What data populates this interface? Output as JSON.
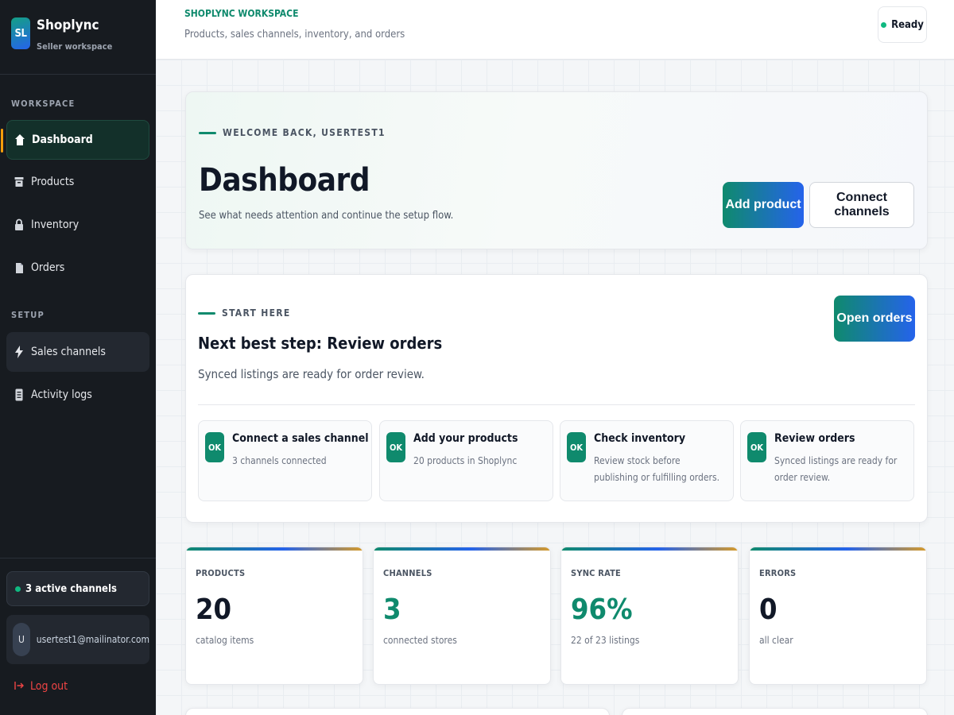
{
  "brand": {
    "logo": "SL",
    "name": "Shoplync",
    "subtitle": "Seller workspace"
  },
  "sidebar": {
    "workspace_label": "WORKSPACE",
    "workspace_items": [
      {
        "label": "Dashboard",
        "icon": "home-icon",
        "active": true
      },
      {
        "label": "Products",
        "icon": "box-icon"
      },
      {
        "label": "Inventory",
        "icon": "lock-icon"
      },
      {
        "label": "Orders",
        "icon": "document-icon"
      }
    ],
    "setup_label": "SETUP",
    "setup_items": [
      {
        "label": "Sales channels",
        "icon": "lightning-icon"
      },
      {
        "label": "Activity logs",
        "icon": "log-icon"
      }
    ],
    "channels_status": "3 active channels",
    "user": {
      "initial": "U",
      "email": "usertest1@mailinator.com"
    },
    "logout_label": "Log out"
  },
  "header": {
    "title": "SHOPLYNC WORKSPACE",
    "subtitle": "Products, sales channels, inventory, and orders",
    "status": "Ready"
  },
  "hero": {
    "eyebrow": "WELCOME BACK, USERTEST1",
    "title": "Dashboard",
    "subtitle": "See what needs attention and continue the setup flow.",
    "primary_button": "Add product",
    "secondary_button": "Connect channels"
  },
  "start": {
    "eyebrow": "START HERE",
    "title": "Next best step: Review orders",
    "subtitle": "Synced listings are ready for order review.",
    "button": "Open orders",
    "steps": [
      {
        "badge": "OK",
        "title": "Connect a sales channel",
        "desc": "3 channels connected"
      },
      {
        "badge": "OK",
        "title": "Add your products",
        "desc": "20 products in Shoplync"
      },
      {
        "badge": "OK",
        "title": "Check inventory",
        "desc": "Review stock before publishing or fulfilling orders."
      },
      {
        "badge": "OK",
        "title": "Review orders",
        "desc": "Synced listings are ready for order review."
      }
    ]
  },
  "stats": [
    {
      "label": "PRODUCTS",
      "value": "20",
      "caption": "catalog items"
    },
    {
      "label": "CHANNELS",
      "value": "3",
      "caption": "connected stores"
    },
    {
      "label": "SYNC RATE",
      "value": "96%",
      "caption": "22 of 23 listings"
    },
    {
      "label": "ERRORS",
      "value": "0",
      "caption": "all clear"
    }
  ],
  "colors": {
    "accent": "#0f8a6d",
    "accent_blue": "#2563eb",
    "sidebar_bg": "#171b20",
    "danger": "#ef4444",
    "warning": "#f59e0b"
  }
}
